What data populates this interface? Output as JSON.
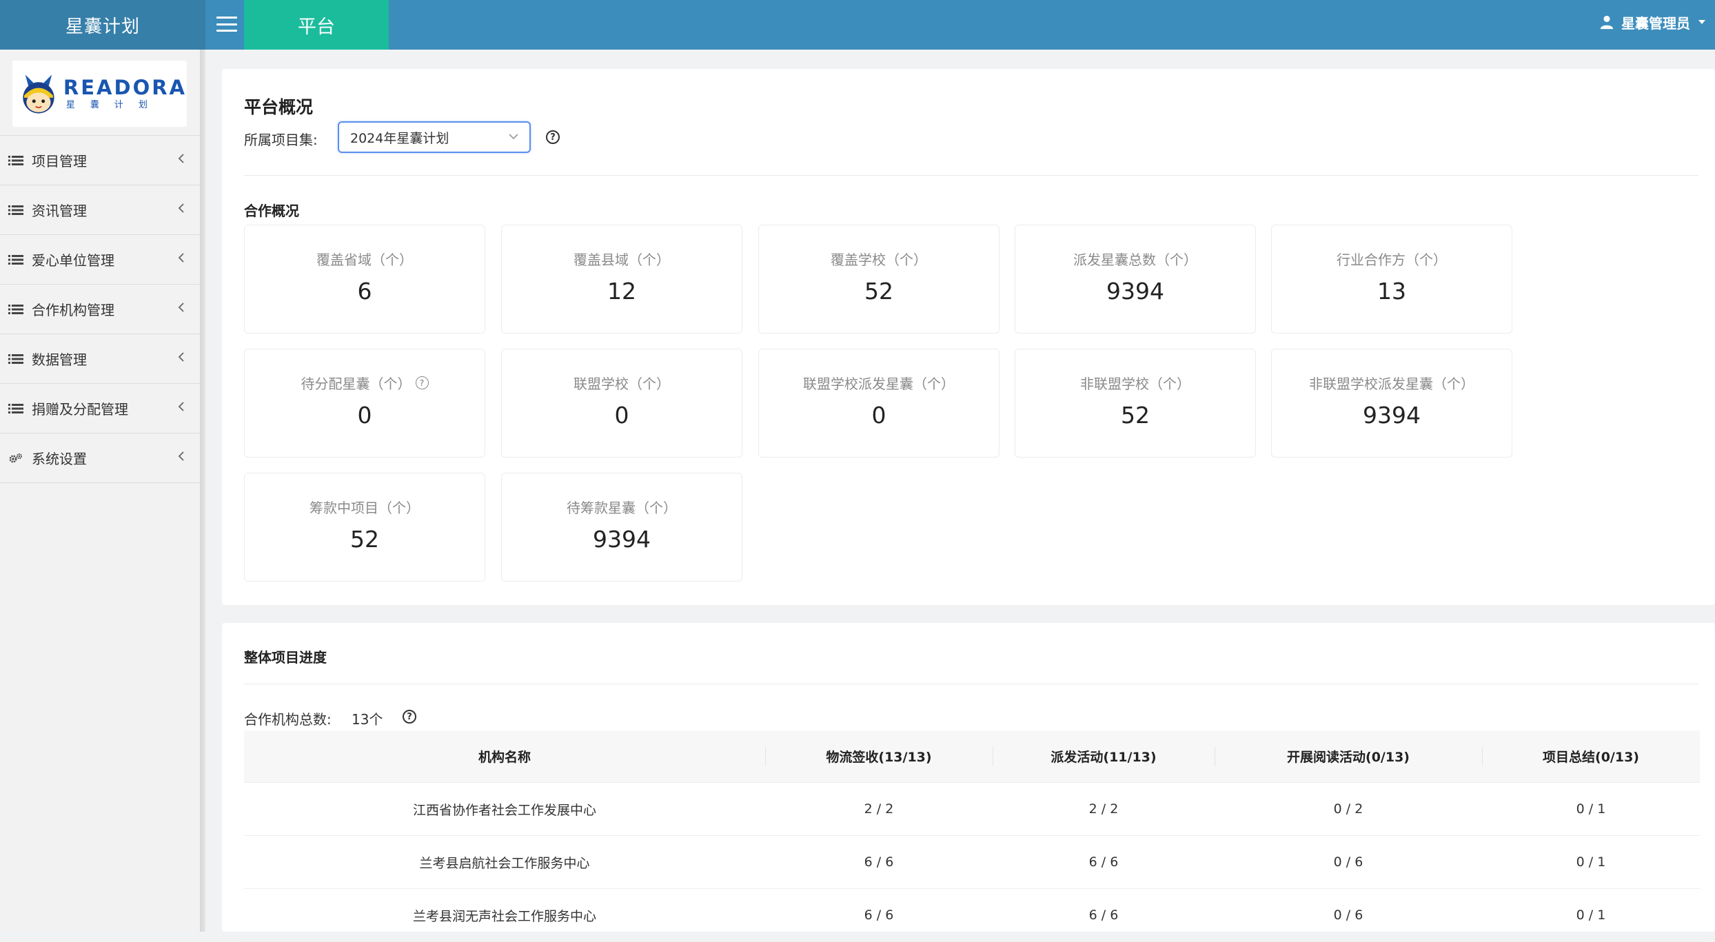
{
  "header": {
    "brand": "星囊计划",
    "active_tab": "平台",
    "user_name": "星囊管理员"
  },
  "logo": {
    "title": "READORA",
    "subtitle": "星囊计划"
  },
  "sidebar": {
    "items": [
      {
        "label": "项目管理",
        "icon": "list-icon"
      },
      {
        "label": "资讯管理",
        "icon": "list-icon"
      },
      {
        "label": "爱心单位管理",
        "icon": "list-icon"
      },
      {
        "label": "合作机构管理",
        "icon": "list-icon"
      },
      {
        "label": "数据管理",
        "icon": "list-icon"
      },
      {
        "label": "捐赠及分配管理",
        "icon": "list-icon"
      },
      {
        "label": "系统设置",
        "icon": "gears-icon"
      }
    ]
  },
  "overview": {
    "title": "平台概况",
    "filter_label": "所属项目集:",
    "filter_value": "2024年星囊计划",
    "section_title": "合作概况",
    "stats": [
      {
        "label": "覆盖省域（个）",
        "value": "6"
      },
      {
        "label": "覆盖县域（个）",
        "value": "12"
      },
      {
        "label": "覆盖学校（个）",
        "value": "52"
      },
      {
        "label": "派发星囊总数（个）",
        "value": "9394"
      },
      {
        "label": "行业合作方（个）",
        "value": "13"
      },
      {
        "label": "待分配星囊（个）",
        "value": "0"
      },
      {
        "label": "联盟学校（个）",
        "value": "0"
      },
      {
        "label": "联盟学校派发星囊（个）",
        "value": "0"
      },
      {
        "label": "非联盟学校（个）",
        "value": "52"
      },
      {
        "label": "非联盟学校派发星囊（个）",
        "value": "9394"
      },
      {
        "label": "筹款中项目（个）",
        "value": "52"
      },
      {
        "label": "待筹款星囊（个）",
        "value": "9394"
      }
    ]
  },
  "progress": {
    "title": "整体项目进度",
    "org_count_label": "合作机构总数:",
    "org_count_value": "13个",
    "columns": [
      "机构名称",
      "物流签收(13/13)",
      "派发活动(11/13)",
      "开展阅读活动(0/13)",
      "项目总结(0/13)"
    ],
    "rows": [
      [
        "江西省协作者社会工作发展中心",
        "2 / 2",
        "2 / 2",
        "0 / 2",
        "0 / 1"
      ],
      [
        "兰考县启航社会工作服务中心",
        "6 / 6",
        "6 / 6",
        "0 / 6",
        "0 / 1"
      ],
      [
        "兰考县润无声社会工作服务中心",
        "6 / 6",
        "6 / 6",
        "0 / 6",
        "0 / 1"
      ]
    ]
  }
}
